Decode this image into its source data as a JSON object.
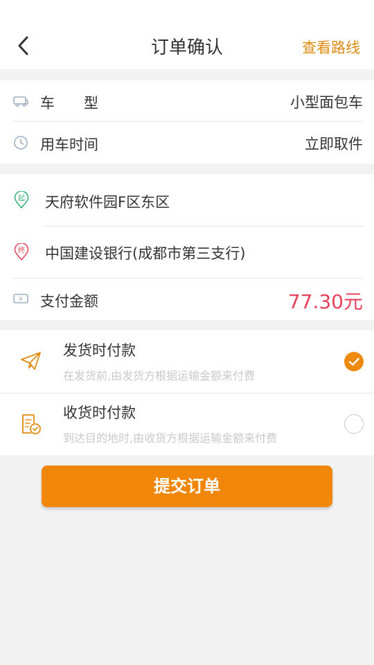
{
  "header": {
    "title": "订单确认",
    "route_link": "查看路线"
  },
  "vehicle": {
    "type_label": "车　　型",
    "type_value": "小型面包车",
    "time_label": "用车时间",
    "time_value": "立即取件"
  },
  "addresses": {
    "start_marker": "起",
    "start": "天府软件园F区东区",
    "end_marker": "终",
    "end": "中国建设银行(成都市第三支行)"
  },
  "payment": {
    "amount_label": "支付金额",
    "amount_value": "77.30元",
    "money_symbol": "¥"
  },
  "pay_options": [
    {
      "title": "发货时付款",
      "desc": "在发货前,由发货方根据运输金额来付费",
      "selected": true
    },
    {
      "title": "收货时付款",
      "desc": "到达目的地时,由收货方根据运输金额来付费",
      "selected": false
    }
  ],
  "submit_label": "提交订单",
  "colors": {
    "accent_orange": "#f0870b",
    "link_orange": "#e08a10",
    "amount_red": "#e8415a",
    "start_green": "#3bb07a",
    "end_red": "#e04a60",
    "icon_gray_blue": "#9fb0c4"
  }
}
